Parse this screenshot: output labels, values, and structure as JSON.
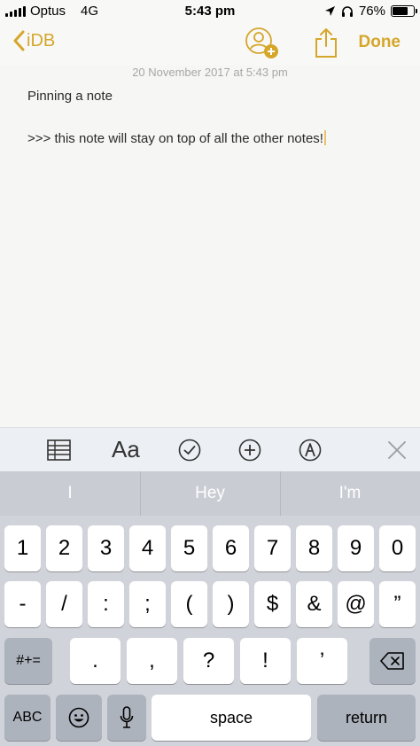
{
  "status_bar": {
    "carrier": "Optus",
    "network": "4G",
    "time": "5:43 pm",
    "battery": "76%",
    "battery_level": 0.76
  },
  "nav": {
    "back_label": "iDB",
    "done_label": "Done",
    "accent_color": "#d5a62a"
  },
  "note": {
    "date": "20 November 2017 at 5:43 pm",
    "lines": [
      "Pinning a note",
      ">>> this note will stay on top of all the other notes!"
    ]
  },
  "toolbar": {
    "format_label": "Aa"
  },
  "predictions": [
    "I",
    "Hey",
    "I'm"
  ],
  "keys": {
    "row1": [
      "1",
      "2",
      "3",
      "4",
      "5",
      "6",
      "7",
      "8",
      "9",
      "0"
    ],
    "row2": [
      "-",
      "/",
      ":",
      ";",
      "(",
      ")",
      "$",
      "&",
      "@",
      "”"
    ],
    "row3_mode": "#+=",
    "row3": [
      ".",
      ",",
      "?",
      "!",
      "’"
    ],
    "abc": "ABC",
    "space": "space",
    "return": "return"
  }
}
